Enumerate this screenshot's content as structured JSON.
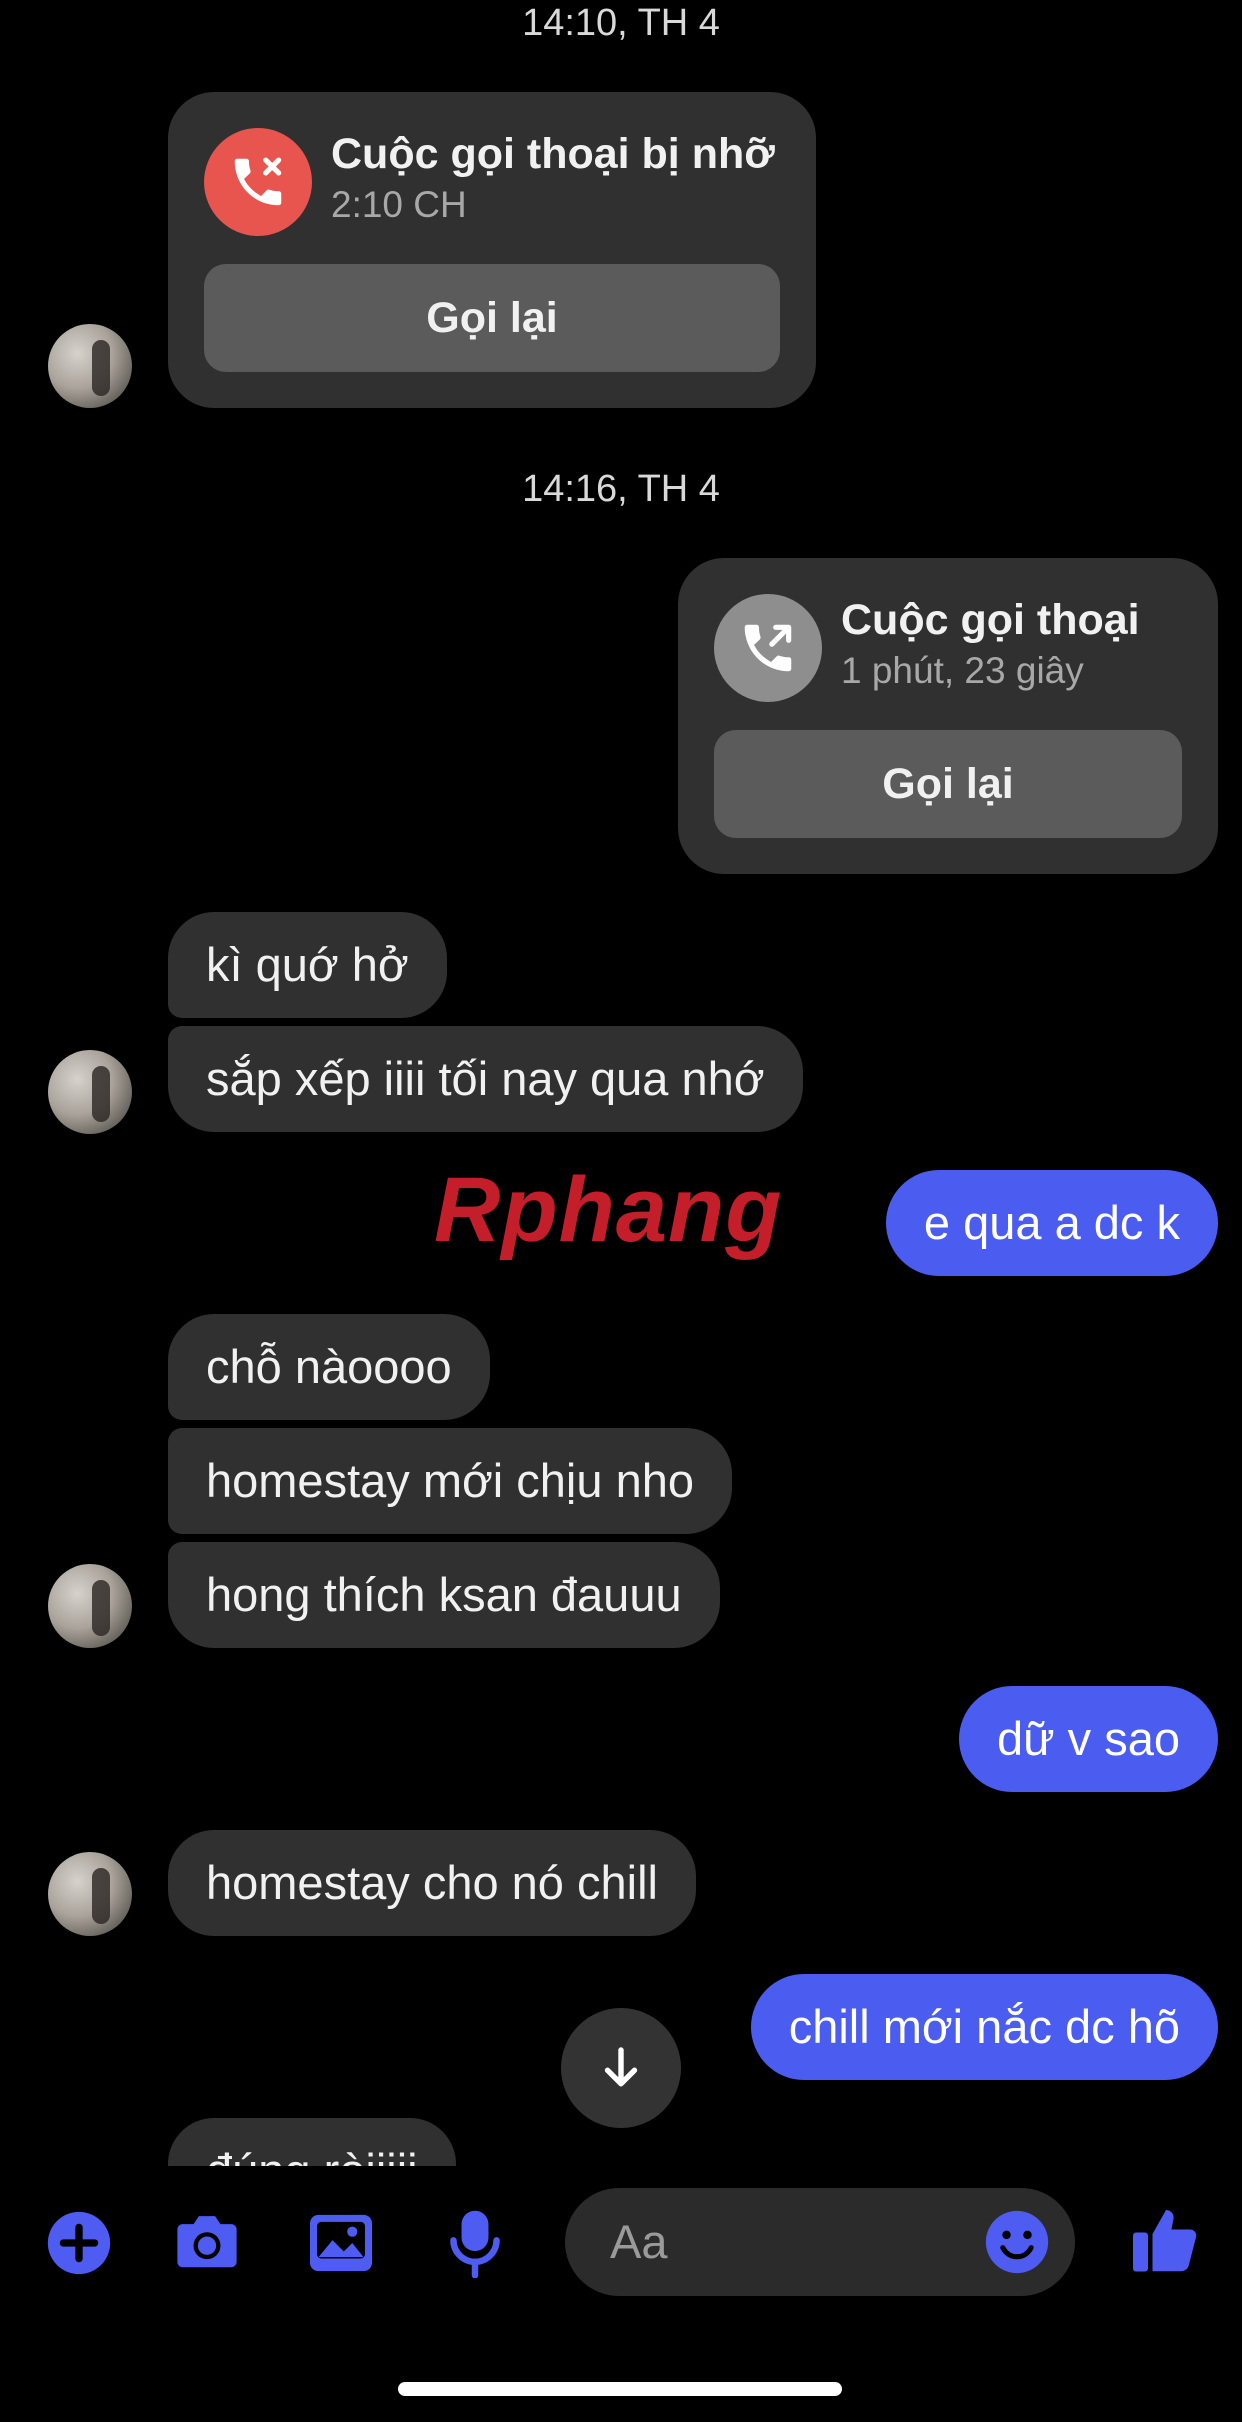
{
  "timestamps": [
    "14:10, TH 4",
    "14:16, TH 4"
  ],
  "calls": [
    {
      "title": "Cuộc gọi thoại bị nhỡ",
      "subtitle": "2:10 CH",
      "button": "Gọi lại",
      "direction": "incoming-missed",
      "icon": "missed-call-icon",
      "icon_color": "#e8554e"
    },
    {
      "title": "Cuộc gọi thoại",
      "subtitle": "1 phút, 23 giây",
      "button": "Gọi lại",
      "direction": "outgoing",
      "icon": "outgoing-call-icon",
      "icon_color": "#8e8e8e"
    }
  ],
  "messages": [
    {
      "from": "them",
      "text": "kì quớ hở"
    },
    {
      "from": "them",
      "text": "sắp xếp iiii tối nay qua nhớ"
    },
    {
      "from": "me",
      "text": "e qua a dc k"
    },
    {
      "from": "them",
      "text": "chỗ nàoooo"
    },
    {
      "from": "them",
      "text": "homestay mới chịu nho"
    },
    {
      "from": "them",
      "text": "hong thích ksan đauuu"
    },
    {
      "from": "me",
      "text": "dữ v sao"
    },
    {
      "from": "them",
      "text": "homestay cho nó chill"
    },
    {
      "from": "me",
      "text": "chill mới nắc dc hõ"
    },
    {
      "from": "them",
      "text": "đúng ròiiiii"
    }
  ],
  "watermark": "Rphang",
  "composer": {
    "placeholder": "Aa",
    "tools": [
      "plus-icon",
      "camera-icon",
      "image-icon",
      "microphone-icon"
    ],
    "emoji_icon": "emoji-icon",
    "like_icon": "thumbs-up-icon"
  },
  "colors": {
    "accent": "#4b5cf0",
    "incoming_bubble": "#303030",
    "missed_call": "#e8554e",
    "tool_icon": "#4f5cf2"
  }
}
